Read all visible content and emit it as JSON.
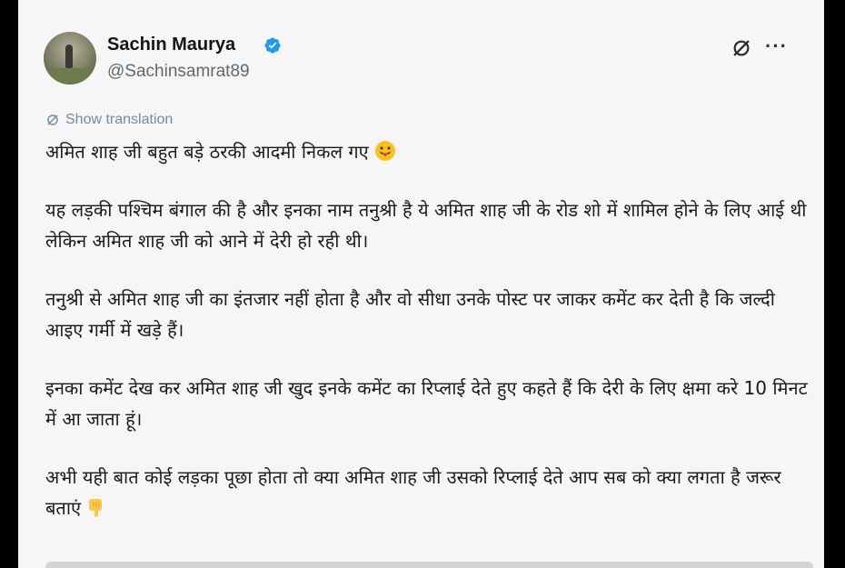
{
  "post": {
    "author_name": "Sachin Maurya",
    "author_handle": "@Sachinsamrat89",
    "translate_label": "Show translation",
    "paragraphs": [
      "अमित शाह जी बहुत बड़े ठरकी आदमी निकल गए",
      "यह लड़की पश्चिम बंगाल की है और इनका नाम तनुश्री है ये अमित शाह जी के रोड शो में शामिल होने के लिए आई थी लेकिन अमित शाह जी को आने में देरी हो रही थी।",
      "तनुश्री से अमित शाह जी का इंतजार नहीं होता है और वो सीधा उनके पोस्ट पर जाकर कमेंट कर देती है कि जल्दी आइए गर्मी में खड़े हैं।",
      "इनका कमेंट देख कर अमित शाह जी खुद इनके कमेंट का रिप्लाई देते हुए कहते हैं कि देरी के लिए क्षमा करे 10 मिनट में आ जाता हूं।",
      "अभी यही बात कोई लड़का पूछा होता तो क्या अमित शाह जी उसको रिप्लाई देते आप सब को क्या लगता है जरूर बताएं"
    ]
  },
  "icons": {
    "verified": "verified-badge-icon",
    "grok": "grok-icon",
    "more": "more-options-icon",
    "translate": "translate-icon",
    "emoji_tongue": "face-with-tongue-emoji",
    "emoji_point_down": "backhand-index-pointing-down-emoji"
  },
  "colors": {
    "verified_blue": "#1d9bf0",
    "translate_link": "#6f8da3",
    "handle_gray": "#5f6870"
  }
}
